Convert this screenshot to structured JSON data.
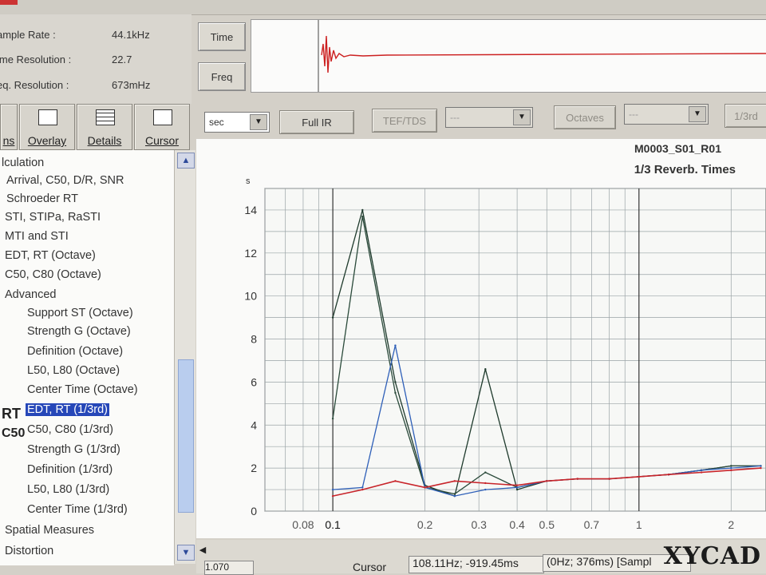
{
  "info": {
    "rows": [
      {
        "label": "ample Rate :",
        "value": "44.1kHz"
      },
      {
        "label": "ime Resolution :",
        "value": "22.7"
      },
      {
        "label": "eq. Resolution :",
        "value": "673mHz"
      }
    ]
  },
  "view_buttons": {
    "time": "Time",
    "freq": "Freq"
  },
  "tabs": {
    "partial": "ns",
    "overlay": "Overlay",
    "details": "Details",
    "cursor": "Cursor"
  },
  "tree": {
    "items": [
      {
        "label": "lculation"
      },
      {
        "label": "Arrival, C50, D/R, SNR"
      },
      {
        "label": "Schroeder RT"
      },
      {
        "label": "STI, STIPa, RaSTI"
      },
      {
        "label": "MTI and STI"
      },
      {
        "label": "EDT, RT (Octave)"
      },
      {
        "label": "C50, C80 (Octave)"
      },
      {
        "label": "Advanced"
      },
      {
        "label": "Support ST (Octave)"
      },
      {
        "label": "Strength G (Octave)"
      },
      {
        "label": "Definition (Octave)"
      },
      {
        "label": "L50, L80 (Octave)"
      },
      {
        "label": "Center Time (Octave)"
      },
      {
        "label": "EDT, RT (1/3rd)"
      },
      {
        "label": "C50, C80 (1/3rd)"
      },
      {
        "label": "Strength G (1/3rd)"
      },
      {
        "label": "Definition (1/3rd)"
      },
      {
        "label": "L50, L80 (1/3rd)"
      },
      {
        "label": "Center Time (1/3rd)"
      },
      {
        "label": "Spatial Measures"
      },
      {
        "label": "Distortion"
      }
    ],
    "icon_rt": "RT",
    "icon_c50": "C50"
  },
  "toolbar": {
    "unit_select": "sec",
    "full_ir": "Full IR",
    "tef_tds": "TEF/TDS",
    "combo2": "---",
    "octaves": "Octaves",
    "combo3": "---",
    "third": "1/3rd"
  },
  "chart_header": {
    "title": "M0003_S01_R01",
    "subtitle": "1/3 Reverb. Times"
  },
  "status": {
    "left_value": "1.070",
    "cursor_label": "Cursor",
    "cursor_value": "108.11Hz; -919.45ms",
    "range_value": "(0Hz; 376ms) [Sampl"
  },
  "watermark": "XYCAD",
  "colors": {
    "selection": "#2647b8",
    "series_dark": "#1e3a2c",
    "series_blue": "#2e5fb8",
    "series_red": "#c8242a"
  },
  "chart_data": {
    "type": "line",
    "title": "1/3 Reverb. Times",
    "ylabel": "s",
    "xscale": "log",
    "xlim": [
      0.06,
      2.6
    ],
    "ylim": [
      0,
      15
    ],
    "yticks": [
      0,
      2,
      4,
      6,
      8,
      10,
      12,
      14
    ],
    "xticks": [
      {
        "v": 0.08,
        "label": "0.08"
      },
      {
        "v": 0.1,
        "label": "0.1"
      },
      {
        "v": 0.2,
        "label": "0.2"
      },
      {
        "v": 0.3,
        "label": "0.3"
      },
      {
        "v": 0.4,
        "label": "0.4"
      },
      {
        "v": 0.5,
        "label": "0.5"
      },
      {
        "v": 0.7,
        "label": "0.7"
      },
      {
        "v": 1,
        "label": "1"
      },
      {
        "v": 2,
        "label": "2"
      }
    ],
    "grid": true,
    "series": [
      {
        "color": "#1e3a2c",
        "x": [
          0.1,
          0.125,
          0.16,
          0.2,
          0.25,
          0.315,
          0.4,
          0.5,
          0.63,
          0.8,
          1.0,
          1.25,
          1.6,
          2.0,
          2.5
        ],
        "y": [
          9.0,
          14.0,
          6.0,
          1.2,
          0.7,
          6.6,
          1.0,
          1.4,
          1.5,
          1.5,
          1.6,
          1.7,
          1.9,
          2.1,
          2.1
        ]
      },
      {
        "color": "#2a4a3a",
        "x": [
          0.1,
          0.125,
          0.16,
          0.2,
          0.25,
          0.315,
          0.4,
          0.5,
          0.63,
          0.8,
          1.0,
          1.25,
          1.6,
          2.0,
          2.5
        ],
        "y": [
          4.3,
          13.7,
          5.5,
          1.1,
          0.8,
          1.8,
          1.1,
          1.4,
          1.5,
          1.5,
          1.6,
          1.7,
          1.9,
          2.1,
          2.1
        ]
      },
      {
        "color": "#2e5fb8",
        "x": [
          0.1,
          0.125,
          0.16,
          0.2,
          0.25,
          0.315,
          0.4,
          0.5,
          0.63,
          0.8,
          1.0,
          1.25,
          1.6,
          2.0,
          2.5
        ],
        "y": [
          1.0,
          1.1,
          7.7,
          1.1,
          0.7,
          1.0,
          1.1,
          1.4,
          1.5,
          1.5,
          1.6,
          1.7,
          1.9,
          2.0,
          2.1
        ]
      },
      {
        "color": "#c8242a",
        "x": [
          0.1,
          0.125,
          0.16,
          0.2,
          0.25,
          0.315,
          0.4,
          0.5,
          0.63,
          0.8,
          1.0,
          1.25,
          1.6,
          2.0,
          2.5
        ],
        "y": [
          0.7,
          1.0,
          1.4,
          1.1,
          1.4,
          1.3,
          1.2,
          1.4,
          1.5,
          1.5,
          1.6,
          1.7,
          1.8,
          1.9,
          2.0
        ]
      }
    ]
  }
}
